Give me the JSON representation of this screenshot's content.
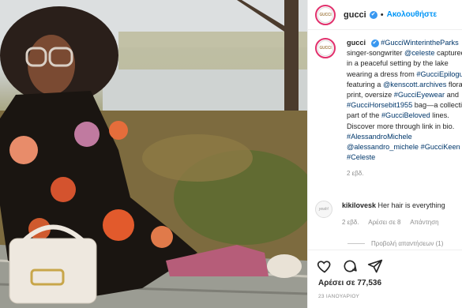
{
  "post": {
    "username": "gucci",
    "verified_mark": "✔",
    "separator": "•",
    "follow_label": "Ακολουθήστε",
    "avatar_text": "GUCCI",
    "caption_lines": [
      [
        {
          "t": "gucci",
          "c": "b"
        },
        {
          "t": " ✔ ",
          "c": "verified"
        },
        {
          "t": "#GucciWinterintheParks",
          "c": "tag"
        }
      ],
      [
        {
          "t": "singer-songwriter ",
          "c": ""
        },
        {
          "t": "@celeste",
          "c": "tag"
        },
        {
          "t": " captured",
          "c": ""
        }
      ],
      [
        {
          "t": "in a peaceful setting by the lake",
          "c": ""
        }
      ],
      [
        {
          "t": "wearing a dress from ",
          "c": ""
        },
        {
          "t": "#GucciEpilogue",
          "c": "tag"
        }
      ],
      [
        {
          "t": "featuring a ",
          "c": ""
        },
        {
          "t": "@kenscott.archives",
          "c": "tag"
        },
        {
          "t": " floral",
          "c": ""
        }
      ],
      [
        {
          "t": "print, oversize ",
          "c": ""
        },
        {
          "t": "#GucciEyewear",
          "c": "tag"
        },
        {
          "t": " and",
          "c": ""
        }
      ],
      [
        {
          "t": "#GucciHorsebit1955",
          "c": "tag"
        },
        {
          "t": " bag—a collection",
          "c": ""
        }
      ],
      [
        {
          "t": "part of the ",
          "c": ""
        },
        {
          "t": "#GucciBeloved",
          "c": "tag"
        },
        {
          "t": " lines.",
          "c": ""
        }
      ],
      [
        {
          "t": "Discover more through link in bio.",
          "c": ""
        }
      ],
      [
        {
          "t": "#AlessandroMichele",
          "c": "tag"
        }
      ],
      [
        {
          "t": "@alessandro_michele",
          "c": "tag"
        },
        {
          "t": " ",
          "c": ""
        },
        {
          "t": "#GucciKeen",
          "c": "tag"
        }
      ],
      [
        {
          "t": "#Celeste",
          "c": "tag"
        }
      ]
    ],
    "caption_time": "2 εβδ."
  },
  "comment": {
    "avatar_text": "yeah!",
    "username": "kikilovesk",
    "text": "Her hair is everything",
    "time": "2 εβδ.",
    "likes": "Αρέσει σε 8",
    "reply": "Απάντηση"
  },
  "replies_label": "Προβολή απαντήσεων (1)",
  "icons": [
    "heart-icon",
    "comment-icon",
    "share-icon"
  ],
  "likes_text": "Αρέσει σε 77,536",
  "date_text": "23 ΙΑΝΟΥΑΡΙΟΥ"
}
